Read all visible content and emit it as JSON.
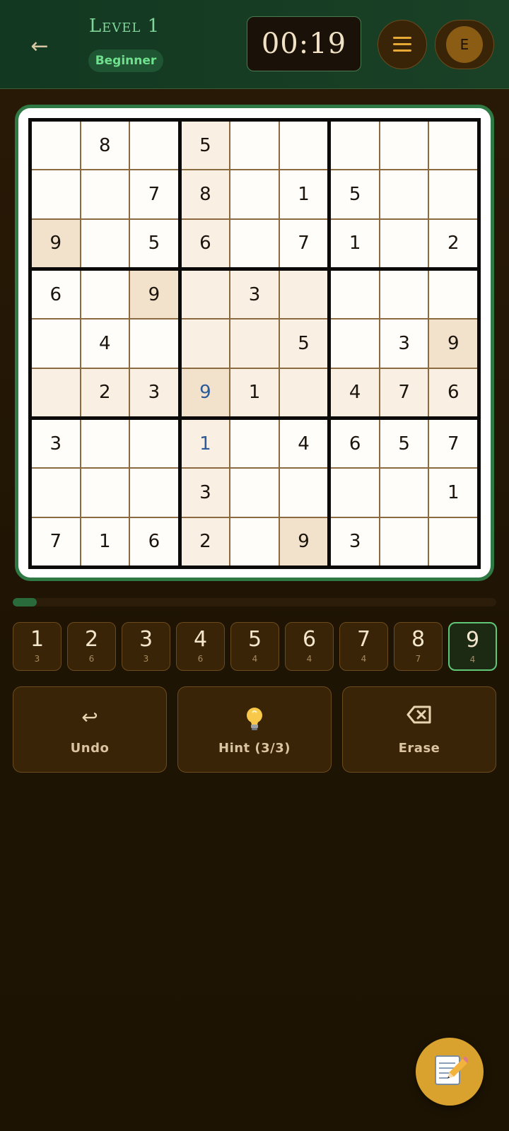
{
  "header": {
    "back_icon": "left-arrow-icon",
    "level_title": "Level 1",
    "difficulty": "Beginner",
    "timer": "00:19",
    "menu_icon": "hamburger-menu-icon",
    "avatar_initial": "E"
  },
  "board": {
    "rows": [
      [
        "",
        "8",
        "",
        "5",
        "",
        "",
        "",
        "",
        ""
      ],
      [
        "",
        "",
        "7",
        "8",
        "",
        "1",
        "5",
        "",
        ""
      ],
      [
        "9",
        "",
        "5",
        "6",
        "",
        "7",
        "1",
        "",
        "2"
      ],
      [
        "6",
        "",
        "9",
        "",
        "3",
        "",
        "",
        "",
        ""
      ],
      [
        "",
        "4",
        "",
        "",
        "",
        "5",
        "",
        "3",
        "9"
      ],
      [
        "",
        "2",
        "3",
        "9",
        "1",
        "",
        "4",
        "7",
        "6"
      ],
      [
        "3",
        "",
        "",
        "1",
        "",
        "4",
        "6",
        "5",
        "7"
      ],
      [
        "",
        "",
        "",
        "3",
        "",
        "",
        "",
        "",
        "1"
      ],
      [
        "7",
        "1",
        "6",
        "2",
        "",
        "9",
        "3",
        "",
        ""
      ]
    ],
    "user_entries": [
      [
        5,
        3
      ],
      [
        6,
        3
      ]
    ],
    "highlighted_cells": [
      [
        2,
        0
      ],
      [
        3,
        2
      ],
      [
        4,
        8
      ],
      [
        5,
        3
      ],
      [
        8,
        5
      ]
    ],
    "selected_column": 3,
    "selected_row": 5,
    "selected_box": [
      3,
      3
    ],
    "colors": {
      "cell": "#fffdf9",
      "related": "#f9efe3",
      "same_number": "#f2e2cc",
      "given_text": "#1b140c",
      "user_text": "#2b5b9a",
      "thin_line": "#8a6a3e",
      "thick_line": "#0c0a08",
      "frame": "#2f7a44"
    }
  },
  "progress": {
    "fraction": 0.05
  },
  "number_pad": {
    "keys": [
      {
        "digit": "1",
        "remaining": "3"
      },
      {
        "digit": "2",
        "remaining": "6"
      },
      {
        "digit": "3",
        "remaining": "3"
      },
      {
        "digit": "4",
        "remaining": "6"
      },
      {
        "digit": "5",
        "remaining": "4"
      },
      {
        "digit": "6",
        "remaining": "4"
      },
      {
        "digit": "7",
        "remaining": "4"
      },
      {
        "digit": "8",
        "remaining": "7"
      },
      {
        "digit": "9",
        "remaining": "4"
      }
    ],
    "selected_digit": "9"
  },
  "actions": {
    "undo": {
      "label": "Undo",
      "icon": "undo-arrow-icon"
    },
    "hint": {
      "label": "Hint (3/3)",
      "icon": "lightbulb-icon"
    },
    "erase": {
      "label": "Erase",
      "icon": "backspace-icon"
    }
  },
  "notes_fab": {
    "icon": "memo-pencil-icon"
  }
}
